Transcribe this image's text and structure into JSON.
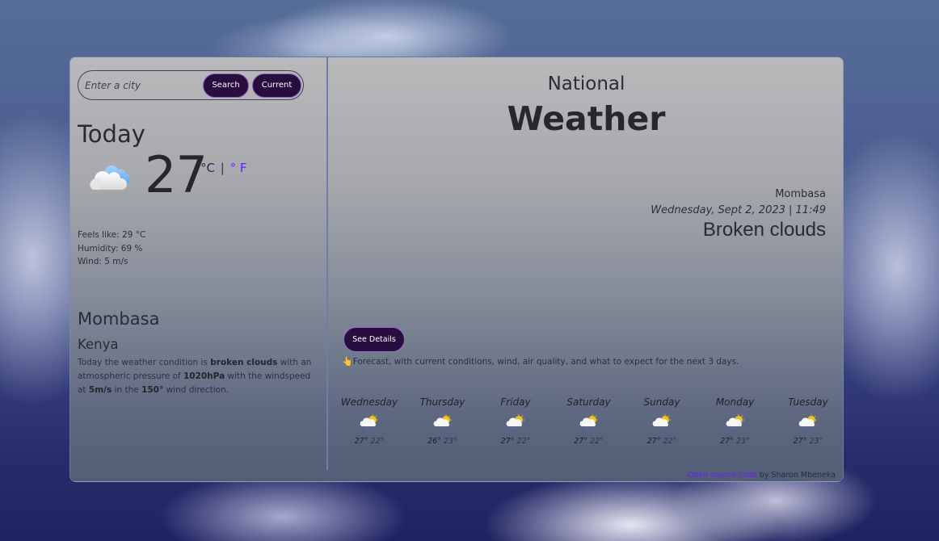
{
  "search": {
    "placeholder": "Enter a city",
    "value": "",
    "search_label": "Search",
    "current_label": "Current"
  },
  "today": {
    "title": "Today",
    "icon": "cloud-icon",
    "temperature": "27",
    "unit_celsius": "°C",
    "unit_separator": "|",
    "unit_fahrenheit": "° F",
    "feels_like": "Feels like: 29 °C",
    "humidity": "Humidity: 69 %",
    "wind": "Wind: 5 m/s"
  },
  "location": {
    "city": "Mombasa",
    "country": "Kenya",
    "description": {
      "part1": "Today the weather condition is ",
      "condition": "broken clouds",
      "part2": " with an atmospheric pressure of ",
      "pressure": "1020hPa",
      "part3": " with the windspeed at ",
      "windspeed": "5m/s",
      "part4": " in the ",
      "direction": "150°",
      "part5": " wind direction."
    }
  },
  "header": {
    "subtitle": "National",
    "title": "Weather"
  },
  "current": {
    "city": "Mombasa",
    "datetime": "Wednesday, Sept 2, 2023 | 11:49",
    "condition": "Broken clouds"
  },
  "details": {
    "button_label": "See Details",
    "note_icon": "pointing-hand-icon",
    "note": "Forecast, with current conditions, wind, air quality, and what to expect for the next 3 days."
  },
  "forecast": [
    {
      "day": "Wednesday",
      "icon": "sun-cloud-rain-icon",
      "max": "27°",
      "min": "22°"
    },
    {
      "day": "Thursday",
      "icon": "sun-cloud-rain-icon",
      "max": "26°",
      "min": "23°"
    },
    {
      "day": "Friday",
      "icon": "sun-cloud-rain-icon",
      "max": "27°",
      "min": "22°"
    },
    {
      "day": "Saturday",
      "icon": "sun-cloud-rain-icon",
      "max": "27°",
      "min": "22°"
    },
    {
      "day": "Sunday",
      "icon": "sun-cloud-rain-icon",
      "max": "27°",
      "min": "22°"
    },
    {
      "day": "Monday",
      "icon": "sun-cloud-rain-icon",
      "max": "27°",
      "min": "23°"
    },
    {
      "day": "Tuesday",
      "icon": "sun-cloud-rain-icon",
      "max": "27°",
      "min": "23°"
    }
  ],
  "footer": {
    "link_label": "Open-source code",
    "author": " by Sharon Mbeneka"
  },
  "colors": {
    "button_bg": "#280d3e",
    "link": "#6a1bff"
  }
}
